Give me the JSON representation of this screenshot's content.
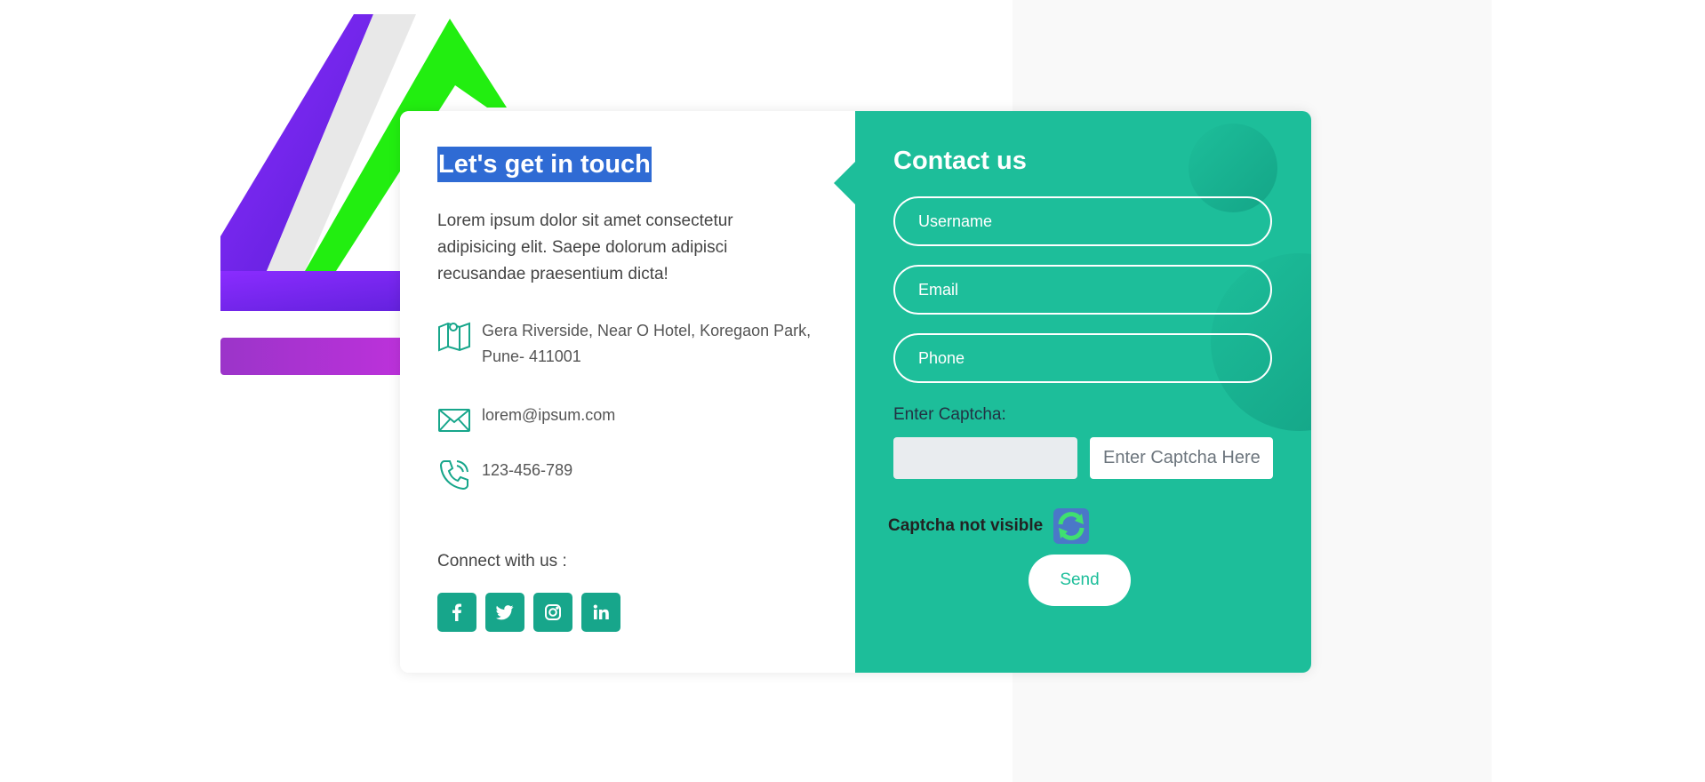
{
  "left": {
    "heading": "Let's get in touch",
    "intro": "Lorem ipsum dolor sit amet consectetur adipisicing elit. Saepe dolorum adipisci recusandae praesentium dicta!",
    "address": "Gera Riverside, Near O Hotel, Koregaon Park, Pune- 411001",
    "email": "lorem@ipsum.com",
    "phone": "123-456-789",
    "connect_label": "Connect with us :",
    "socials": [
      "facebook-icon",
      "twitter-icon",
      "instagram-icon",
      "linkedin-icon"
    ]
  },
  "form": {
    "title": "Contact us",
    "username_placeholder": "Username",
    "email_placeholder": "Email",
    "phone_placeholder": "Phone",
    "captcha_label": "Enter Captcha:",
    "captcha_placeholder": "Enter Captcha Here",
    "captcha_not_visible": "Captcha not visible",
    "send_label": "Send"
  },
  "colors": {
    "accent": "#1dbe9a",
    "social_bg": "#17a68b",
    "heading_highlight": "#2f6bd4"
  }
}
